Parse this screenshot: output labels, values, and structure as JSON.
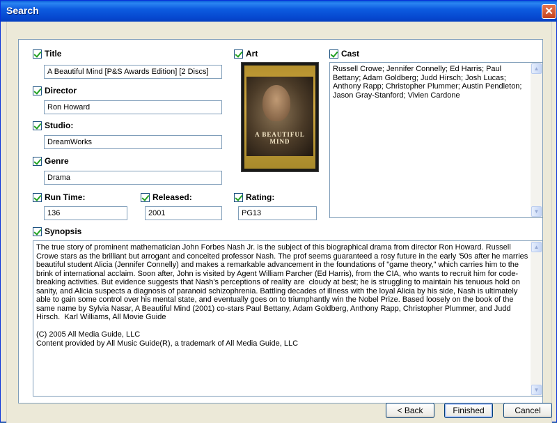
{
  "window": {
    "title": "Search",
    "close_glyph": "✕"
  },
  "fields": {
    "title": {
      "label": "Title",
      "value": "A Beautiful Mind [P&S Awards Edition] [2 Discs]"
    },
    "director": {
      "label": "Director",
      "value": "Ron Howard"
    },
    "studio": {
      "label": "Studio:",
      "value": "DreamWorks"
    },
    "genre": {
      "label": "Genre",
      "value": "Drama"
    },
    "run_time": {
      "label": "Run Time:",
      "value": "136"
    },
    "released": {
      "label": "Released:",
      "value": "2001"
    },
    "rating": {
      "label": "Rating:",
      "value": "PG13"
    },
    "art": {
      "label": "Art"
    },
    "cast": {
      "label": "Cast",
      "value": "Russell Crowe; Jennifer Connelly; Ed Harris; Paul Bettany; Adam Goldberg; Judd Hirsch; Josh Lucas; Anthony Rapp; Christopher Plummer; Austin Pendleton; Jason Gray-Stanford; Vivien Cardone"
    },
    "synopsis": {
      "label": "Synopsis",
      "value": "The true story of prominent mathematician John Forbes Nash Jr. is the subject of this biographical drama from director Ron Howard. Russell Crowe stars as the brilliant but arrogant and conceited professor Nash. The prof seems guaranteed a rosy future in the early '50s after he marries beautiful student Alicia (Jennifer Connelly) and makes a remarkable advancement in the foundations of \"game theory,\" which carries him to the brink of international acclaim. Soon after, John is visited by Agent William Parcher (Ed Harris), from the CIA, who wants to recruit him for code-breaking activities. But evidence suggests that Nash's perceptions of reality are  cloudy at best; he is struggling to maintain his tenuous hold on sanity, and Alicia suspects a diagnosis of paranoid schizophrenia. Battling decades of illness with the loyal Alicia by his side, Nash is ultimately able to gain some control over his mental state, and eventually goes on to triumphantly win the Nobel Prize. Based loosely on the book of the same name by Sylvia Nasar, A Beautiful Mind (2001) co-stars Paul Bettany, Adam Goldberg, Anthony Rapp, Christopher Plummer, and Judd Hirsch.  Karl Williams, All Movie Guide\n\n(C) 2005 All Media Guide, LLC\nContent provided by All Music Guide(R), a trademark of All Media Guide, LLC"
    }
  },
  "poster": {
    "title_text": "A BEAUTIFUL MIND"
  },
  "buttons": {
    "back": "< Back",
    "finished": "Finished",
    "cancel": "Cancel"
  },
  "icons": {
    "checkbox": "checked-checkbox-icon",
    "scroll_up": "▲",
    "scroll_down": "▼"
  }
}
